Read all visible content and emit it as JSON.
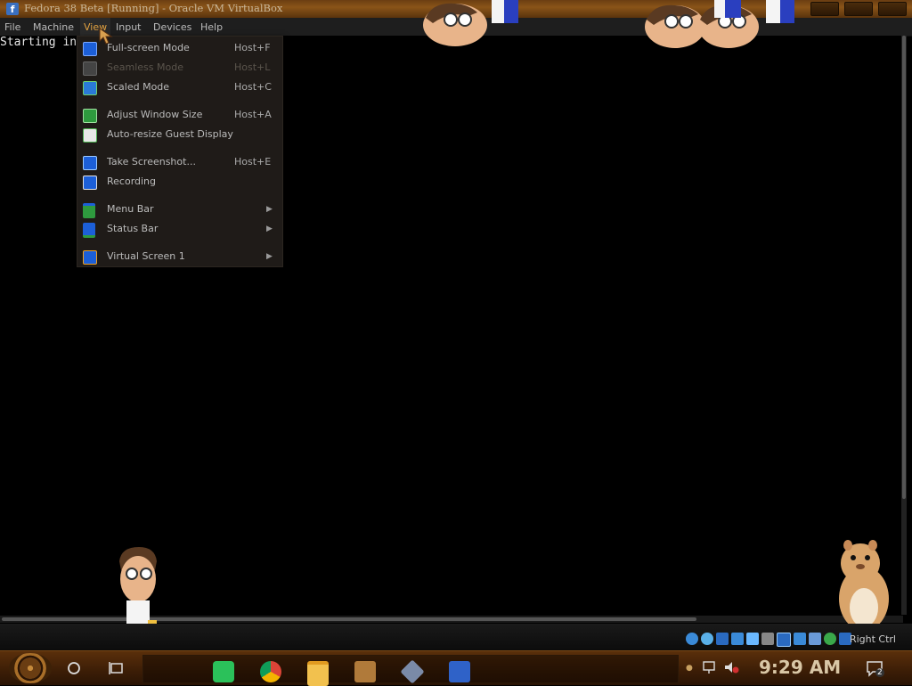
{
  "window": {
    "title": "Fedora 38 Beta [Running] - Oracle VM VirtualBox"
  },
  "menubar": {
    "items": [
      {
        "label": "File"
      },
      {
        "label": "Machine"
      },
      {
        "label": "View",
        "open": true
      },
      {
        "label": "Input"
      },
      {
        "label": "Devices"
      },
      {
        "label": "Help"
      }
    ]
  },
  "console": {
    "text": "Starting in"
  },
  "view_menu": {
    "items": [
      {
        "label": "Full-screen Mode",
        "shortcut": "Host+F",
        "icon": "fullscreen-icon",
        "enabled": true
      },
      {
        "label": "Seamless Mode",
        "shortcut": "Host+L",
        "icon": "seamless-icon",
        "enabled": false
      },
      {
        "label": "Scaled Mode",
        "shortcut": "Host+C",
        "icon": "scaled-icon",
        "enabled": true
      },
      {
        "label": "Adjust Window Size",
        "shortcut": "Host+A",
        "icon": "adjust-window-icon",
        "enabled": true
      },
      {
        "label": "Auto-resize Guest Display",
        "shortcut": "",
        "icon": "auto-resize-icon",
        "enabled": true,
        "checked": true
      },
      {
        "label": "Take Screenshot...",
        "shortcut": "Host+E",
        "icon": "screenshot-icon",
        "enabled": true
      },
      {
        "label": "Recording",
        "shortcut": "",
        "icon": "recording-icon",
        "enabled": true
      },
      {
        "label": "Menu Bar",
        "shortcut": "",
        "icon": "menubar-icon",
        "enabled": true,
        "submenu": true
      },
      {
        "label": "Status Bar",
        "shortcut": "",
        "icon": "statusbar-icon",
        "enabled": true,
        "submenu": true
      },
      {
        "label": "Virtual Screen 1",
        "shortcut": "",
        "icon": "virtual-screen-icon",
        "enabled": true,
        "submenu": true
      }
    ]
  },
  "statusbar": {
    "host_key": "Right Ctrl",
    "icons": [
      "hard-disk-icon",
      "optical-drive-icon",
      "audio-icon",
      "network-icon",
      "usb-icon",
      "shared-folder-icon",
      "display-icon",
      "video-capture-icon",
      "cpu-icon",
      "mouse-integration-icon",
      "keyboard-icon"
    ]
  },
  "taskbar": {
    "clock": "9:29 AM",
    "notification_count": "2",
    "apps": [
      "spotify-icon",
      "chrome-icon",
      "file-explorer-icon",
      "virtualbox-manager-icon",
      "virtualbox-icon",
      "fedora-icon"
    ]
  },
  "colors": {
    "titlebar": "#8a5418",
    "taskbar": "#3b1d06",
    "menu_bg": "#1f1b18",
    "menu_text": "#bbbbbb",
    "menu_active": "#e0a040"
  }
}
